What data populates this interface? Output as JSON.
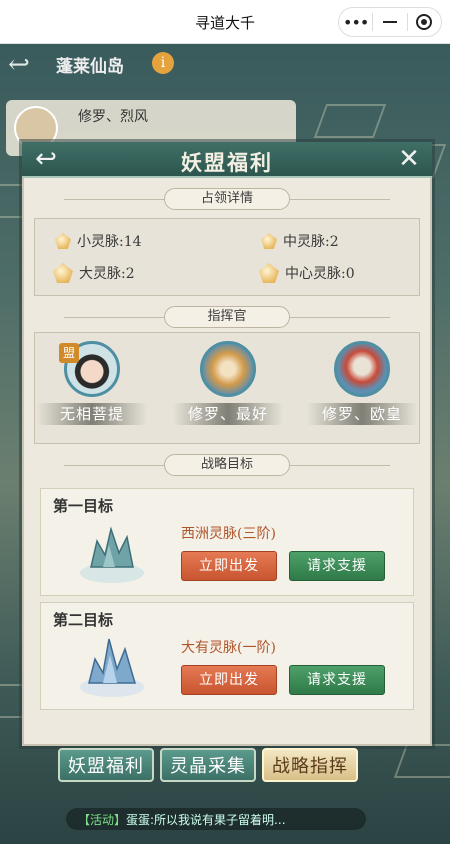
{
  "topbar": {
    "title": "寻道大千"
  },
  "scene": {
    "island_title": "蓬莱仙岛",
    "info": "i",
    "guild_name": "修罗、烈风"
  },
  "modal": {
    "title": "妖盟福利",
    "sections": {
      "occupy": "占领详情",
      "commander": "指挥官",
      "strategy": "战略目标"
    },
    "occupy": {
      "small": "小灵脉:14",
      "medium": "中灵脉:2",
      "large": "大灵脉:2",
      "center": "中心灵脉:0"
    },
    "commanders": [
      {
        "name": "无相菩提",
        "badge": "盟"
      },
      {
        "name": "修罗、最好"
      },
      {
        "name": "修罗、欧皇"
      }
    ],
    "targets": [
      {
        "label": "第一目标",
        "name": "西洲灵脉(三阶)",
        "go": "立即出发",
        "help": "请求支援"
      },
      {
        "label": "第二目标",
        "name": "大有灵脉(一阶)",
        "go": "立即出发",
        "help": "请求支援"
      }
    ]
  },
  "bottom_tabs": [
    "妖盟福利",
    "灵晶采集",
    "战略指挥"
  ],
  "chat": {
    "tag": "【活动】",
    "text": "蛋蛋:所以我说有果子留着明..."
  }
}
